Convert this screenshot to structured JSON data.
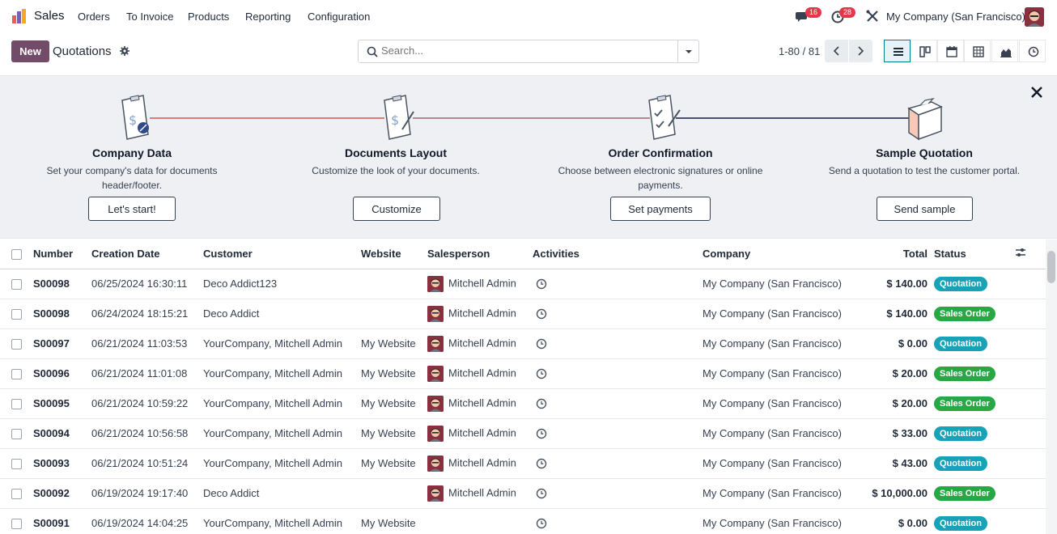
{
  "app": {
    "name": "Sales"
  },
  "menu": [
    "Orders",
    "To Invoice",
    "Products",
    "Reporting",
    "Configuration"
  ],
  "systray": {
    "messages_count": "16",
    "activities_count": "28",
    "company": "My Company (San Francisco)"
  },
  "control": {
    "new_label": "New",
    "title": "Quotations",
    "search_placeholder": "Search...",
    "pager": "1-80 / 81"
  },
  "onboarding": {
    "steps": [
      {
        "title": "Company Data",
        "desc": "Set your company's data for documents header/footer.",
        "button": "Let's start!"
      },
      {
        "title": "Documents Layout",
        "desc": "Customize the look of your documents.",
        "button": "Customize"
      },
      {
        "title": "Order Confirmation",
        "desc": "Choose between electronic signatures or online payments.",
        "button": "Set payments"
      },
      {
        "title": "Sample Quotation",
        "desc": "Send a quotation to test the customer portal.",
        "button": "Send sample"
      }
    ]
  },
  "table": {
    "headers": [
      "Number",
      "Creation Date",
      "Customer",
      "Website",
      "Salesperson",
      "Activities",
      "Company",
      "Total",
      "Status"
    ],
    "rows": [
      [
        "S00098",
        "06/25/2024 16:30:11",
        "Deco Addict123",
        "",
        "Mitchell Admin",
        "",
        "My Company (San Francisco)",
        "$ 140.00",
        "Quotation"
      ],
      [
        "S00098",
        "06/24/2024 18:15:21",
        "Deco Addict",
        "",
        "Mitchell Admin",
        "",
        "My Company (San Francisco)",
        "$ 140.00",
        "Sales Order"
      ],
      [
        "S00097",
        "06/21/2024 11:03:53",
        "YourCompany, Mitchell Admin",
        "My Website",
        "Mitchell Admin",
        "",
        "My Company (San Francisco)",
        "$ 0.00",
        "Quotation"
      ],
      [
        "S00096",
        "06/21/2024 11:01:08",
        "YourCompany, Mitchell Admin",
        "My Website",
        "Mitchell Admin",
        "",
        "My Company (San Francisco)",
        "$ 20.00",
        "Sales Order"
      ],
      [
        "S00095",
        "06/21/2024 10:59:22",
        "YourCompany, Mitchell Admin",
        "My Website",
        "Mitchell Admin",
        "",
        "My Company (San Francisco)",
        "$ 20.00",
        "Sales Order"
      ],
      [
        "S00094",
        "06/21/2024 10:56:58",
        "YourCompany, Mitchell Admin",
        "My Website",
        "Mitchell Admin",
        "",
        "My Company (San Francisco)",
        "$ 33.00",
        "Quotation"
      ],
      [
        "S00093",
        "06/21/2024 10:51:24",
        "YourCompany, Mitchell Admin",
        "My Website",
        "Mitchell Admin",
        "",
        "My Company (San Francisco)",
        "$ 43.00",
        "Quotation"
      ],
      [
        "S00092",
        "06/19/2024 19:17:40",
        "Deco Addict",
        "",
        "Mitchell Admin",
        "",
        "My Company (San Francisco)",
        "$ 10,000.00",
        "Sales Order"
      ],
      [
        "S00091",
        "06/19/2024 14:04:25",
        "YourCompany, Mitchell Admin",
        "My Website",
        "",
        "",
        "My Company (San Francisco)",
        "$ 0.00",
        "Quotation"
      ]
    ]
  },
  "colors": {
    "brand": "#714b67",
    "quotation": "#17a2b8",
    "sales_order": "#28a745",
    "active_view": "#017e84"
  }
}
